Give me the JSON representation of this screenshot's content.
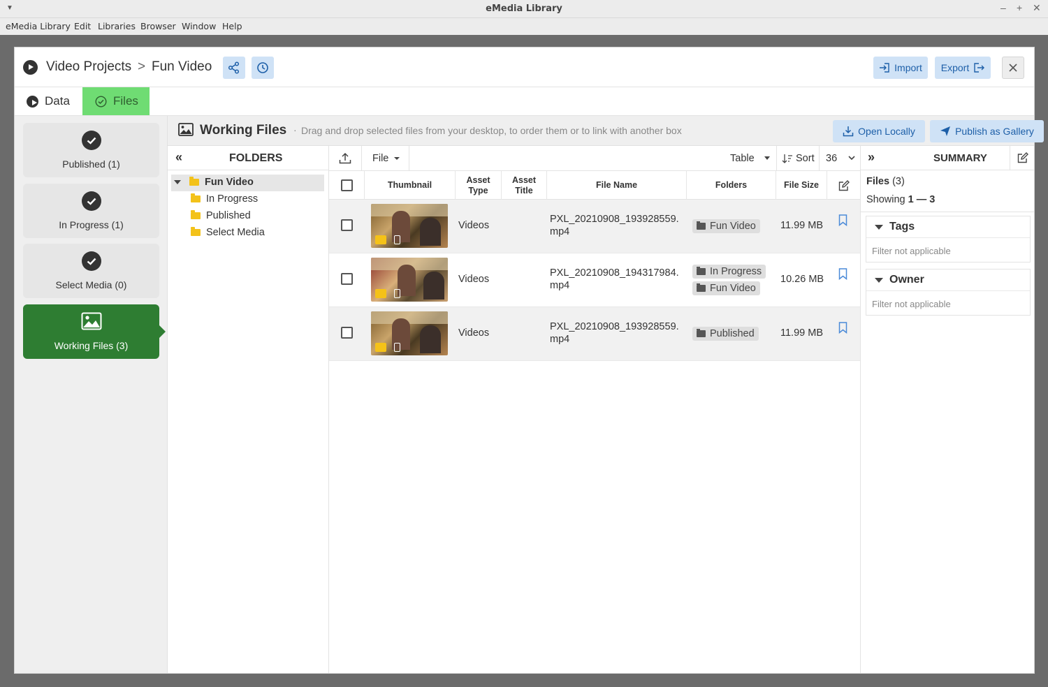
{
  "window": {
    "title": "eMedia Library"
  },
  "menubar": [
    "eMedia Library",
    "Edit",
    "Libraries",
    "Browser",
    "Window",
    "Help"
  ],
  "header": {
    "crumb_parent": "Video Projects",
    "crumb_sep": ">",
    "crumb_current": "Fun Video",
    "import_label": "Import",
    "export_label": "Export"
  },
  "tabs": [
    {
      "label": "Data"
    },
    {
      "label": "Files"
    }
  ],
  "nav": [
    {
      "label": "Published (1)"
    },
    {
      "label": "In Progress (1)"
    },
    {
      "label": "Select Media (0)"
    },
    {
      "label": "Working Files (3)"
    }
  ],
  "workbar": {
    "title": "Working Files",
    "hint": "Drag and drop selected files from your desktop, to order them or to link with another box",
    "open_locally": "Open Locally",
    "publish_gallery": "Publish as Gallery"
  },
  "folders": {
    "header": "FOLDERS",
    "root": "Fun Video",
    "children": [
      "In Progress",
      "Published",
      "Select Media"
    ]
  },
  "toolbar": {
    "file": "File",
    "view": "Table",
    "sort": "Sort",
    "per_page": "36"
  },
  "table": {
    "columns": [
      "Thumbnail",
      "Asset Type",
      "Asset Title",
      "File Name",
      "Folders",
      "File Size"
    ],
    "rows": [
      {
        "type": "Videos",
        "title": "",
        "name1": "PXL_20210908_193928559.",
        "name2": "mp4",
        "folders": [
          "Fun Video"
        ],
        "size": "11.99 MB"
      },
      {
        "type": "Videos",
        "title": "",
        "name1": "PXL_20210908_194317984.",
        "name2": "mp4",
        "folders": [
          "In Progress",
          "Fun Video"
        ],
        "size": "10.26 MB"
      },
      {
        "type": "Videos",
        "title": "",
        "name1": "PXL_20210908_193928559.",
        "name2": "mp4",
        "folders": [
          "Published"
        ],
        "size": "11.99 MB"
      }
    ]
  },
  "summary": {
    "header": "SUMMARY",
    "files_label": "Files",
    "files_count": "(3)",
    "showing_prefix": "Showing",
    "showing_range": "1 — 3",
    "tags": "Tags",
    "owner": "Owner",
    "filter_na": "Filter not applicable"
  },
  "colors": {
    "accent_green": "#2e7d32",
    "tab_green": "#6fdc73",
    "btn_blue_bg": "#cfe2f6",
    "btn_blue_text": "#1d5fa8"
  }
}
